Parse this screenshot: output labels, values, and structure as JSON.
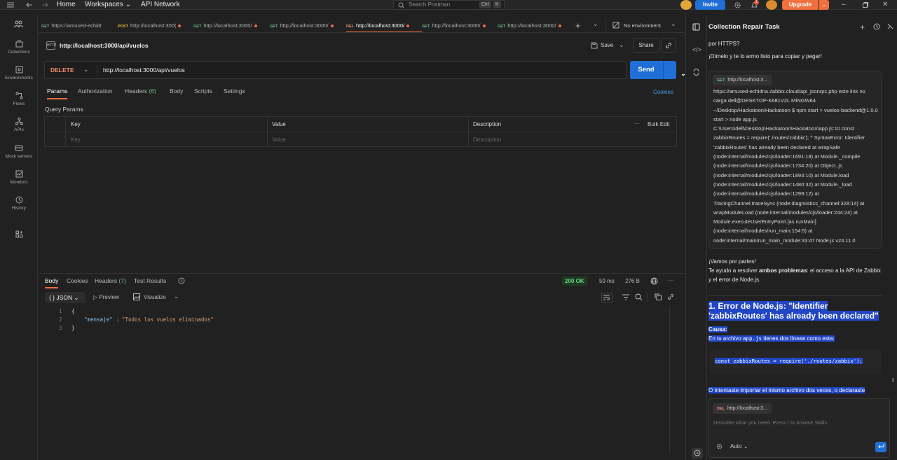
{
  "nav": {
    "home": "Home",
    "workspaces": "Workspaces",
    "api_network": "API Network"
  },
  "search": {
    "placeholder": "Search Postman",
    "kbd1": "Ctrl",
    "kbd2": "K"
  },
  "header": {
    "invite": "Invite",
    "upgrade": "Upgrade",
    "notifications": "1"
  },
  "rail": [
    "Collections",
    "Environments",
    "Flows",
    "APIs",
    "Mock servers",
    "Monitors",
    "History"
  ],
  "tabs": [
    {
      "method": "GET",
      "label": "https://amused-echidr",
      "dot": false
    },
    {
      "method": "POST",
      "label": "http://localhost:300(",
      "dot": true
    },
    {
      "method": "GET",
      "label": "http://localhost:3000/",
      "dot": true
    },
    {
      "method": "GET",
      "label": "http://localhost:3000/",
      "dot": true
    },
    {
      "method": "DEL",
      "label": "http://localhost:3000/",
      "dot": true
    },
    {
      "method": "GET",
      "label": "http://localhost:3000/",
      "dot": true
    },
    {
      "method": "GET",
      "label": "http://localhost:3000/",
      "dot": true
    }
  ],
  "env": "No environment",
  "request": {
    "title": "http://localhost:3000/api/vuelos",
    "save": "Save",
    "share": "Share",
    "method": "DELETE",
    "url": "http://localhost:3000/api/vuelos",
    "send": "Send",
    "subtabs": [
      "Params",
      "Authorization",
      "Headers",
      "Body",
      "Scripts",
      "Settings"
    ],
    "headers_count": "(6)",
    "cookies": "Cookies",
    "query_params": "Query Params",
    "table": {
      "key": "Key",
      "value": "Value",
      "description": "Description",
      "bulk_edit": "Bulk Edit",
      "key_ph": "Key",
      "value_ph": "Value",
      "desc_ph": "Description"
    }
  },
  "response": {
    "tabs": [
      "Body",
      "Cookies",
      "Headers",
      "Test Results"
    ],
    "headers_count": "(7)",
    "status": "200 OK",
    "time": "59 ms",
    "size": "276 B",
    "format": "JSON",
    "preview": "Preview",
    "visualize": "Visualize",
    "lines": [
      "1",
      "2",
      "3"
    ],
    "brace_open": "{",
    "json_key": "\"mensaje\"",
    "colon": ":",
    "json_value": "\"Todos los vuelos eliminados\"",
    "brace_close": "}"
  },
  "panel": {
    "title": "Collection Repair Task",
    "p0": "por HTTPS?",
    "p1": "¡Dímelo y te lo armo listo para copiar y pegar!",
    "chip1_method": "GET",
    "chip1_label": "http://localhost:3...",
    "error_text": "https://amused-echidna.zabbix.cloud/api_jsonrpc.php este link no carga dell@DESKTOP-K681V2L MINGW64 ~/Desktop/Hackatoon/Hackatoon $ npm start > vuelos-backend@1.0.0 start > node app.js C:\\Users\\dell\\Desktop\\Hackatoon\\Hackatoon\\app.js:10 const zabbixRoutes = require('./routes/zabbix'); ^ SyntaxError: Identifier 'zabbixRoutes' has already been declared at wrapSafe (node:internal/modules/cjs/loader:1691:18) at Module._compile (node:internal/modules/cjs/loader:1734:20) at Object..js (node:internal/modules/cjs/loader:1893:10) at Module.load (node:internal/modules/cjs/loader:1480:32) at Module._load (node:internal/modules/cjs/loader:1299:12) at TracingChannel.traceSync (node:diagnostics_channel:328:14) at wrapModuleLoad (node:internal/modules/cjs/loader:244:24) at Module.executeUserEntryPoint [as runMain] (node:internal/modules/run_main:154:5) at node:internal/main/run_main_module:33:47 Node.js v24.11.0",
    "r1": "¡Vamos por partes!",
    "r2a": "Te ayudo a resolver ",
    "r2b": "ambos problemas",
    "r2c": ": el acceso a la API de Zabbix y el error de Node.js.",
    "h1": "1. Error de Node.js: \"Identifier 'zabbixRoutes' has already been declared\"",
    "causa": "Causa:",
    "c1a": "En tu archivo ",
    "c1b": "app.js",
    "c1c": " tienes dos líneas como esta:",
    "codeline": "const zabbixRoutes = require('./routes/zabbix');",
    "c2": "O intentaste importar el mismo archivo dos veces, o declaraste",
    "chip2_method": "DEL",
    "chip2_label": "http://localhost:3...",
    "composer_ph": "Describe what you need. Press / to browse Skills.",
    "auto": "Auto"
  }
}
